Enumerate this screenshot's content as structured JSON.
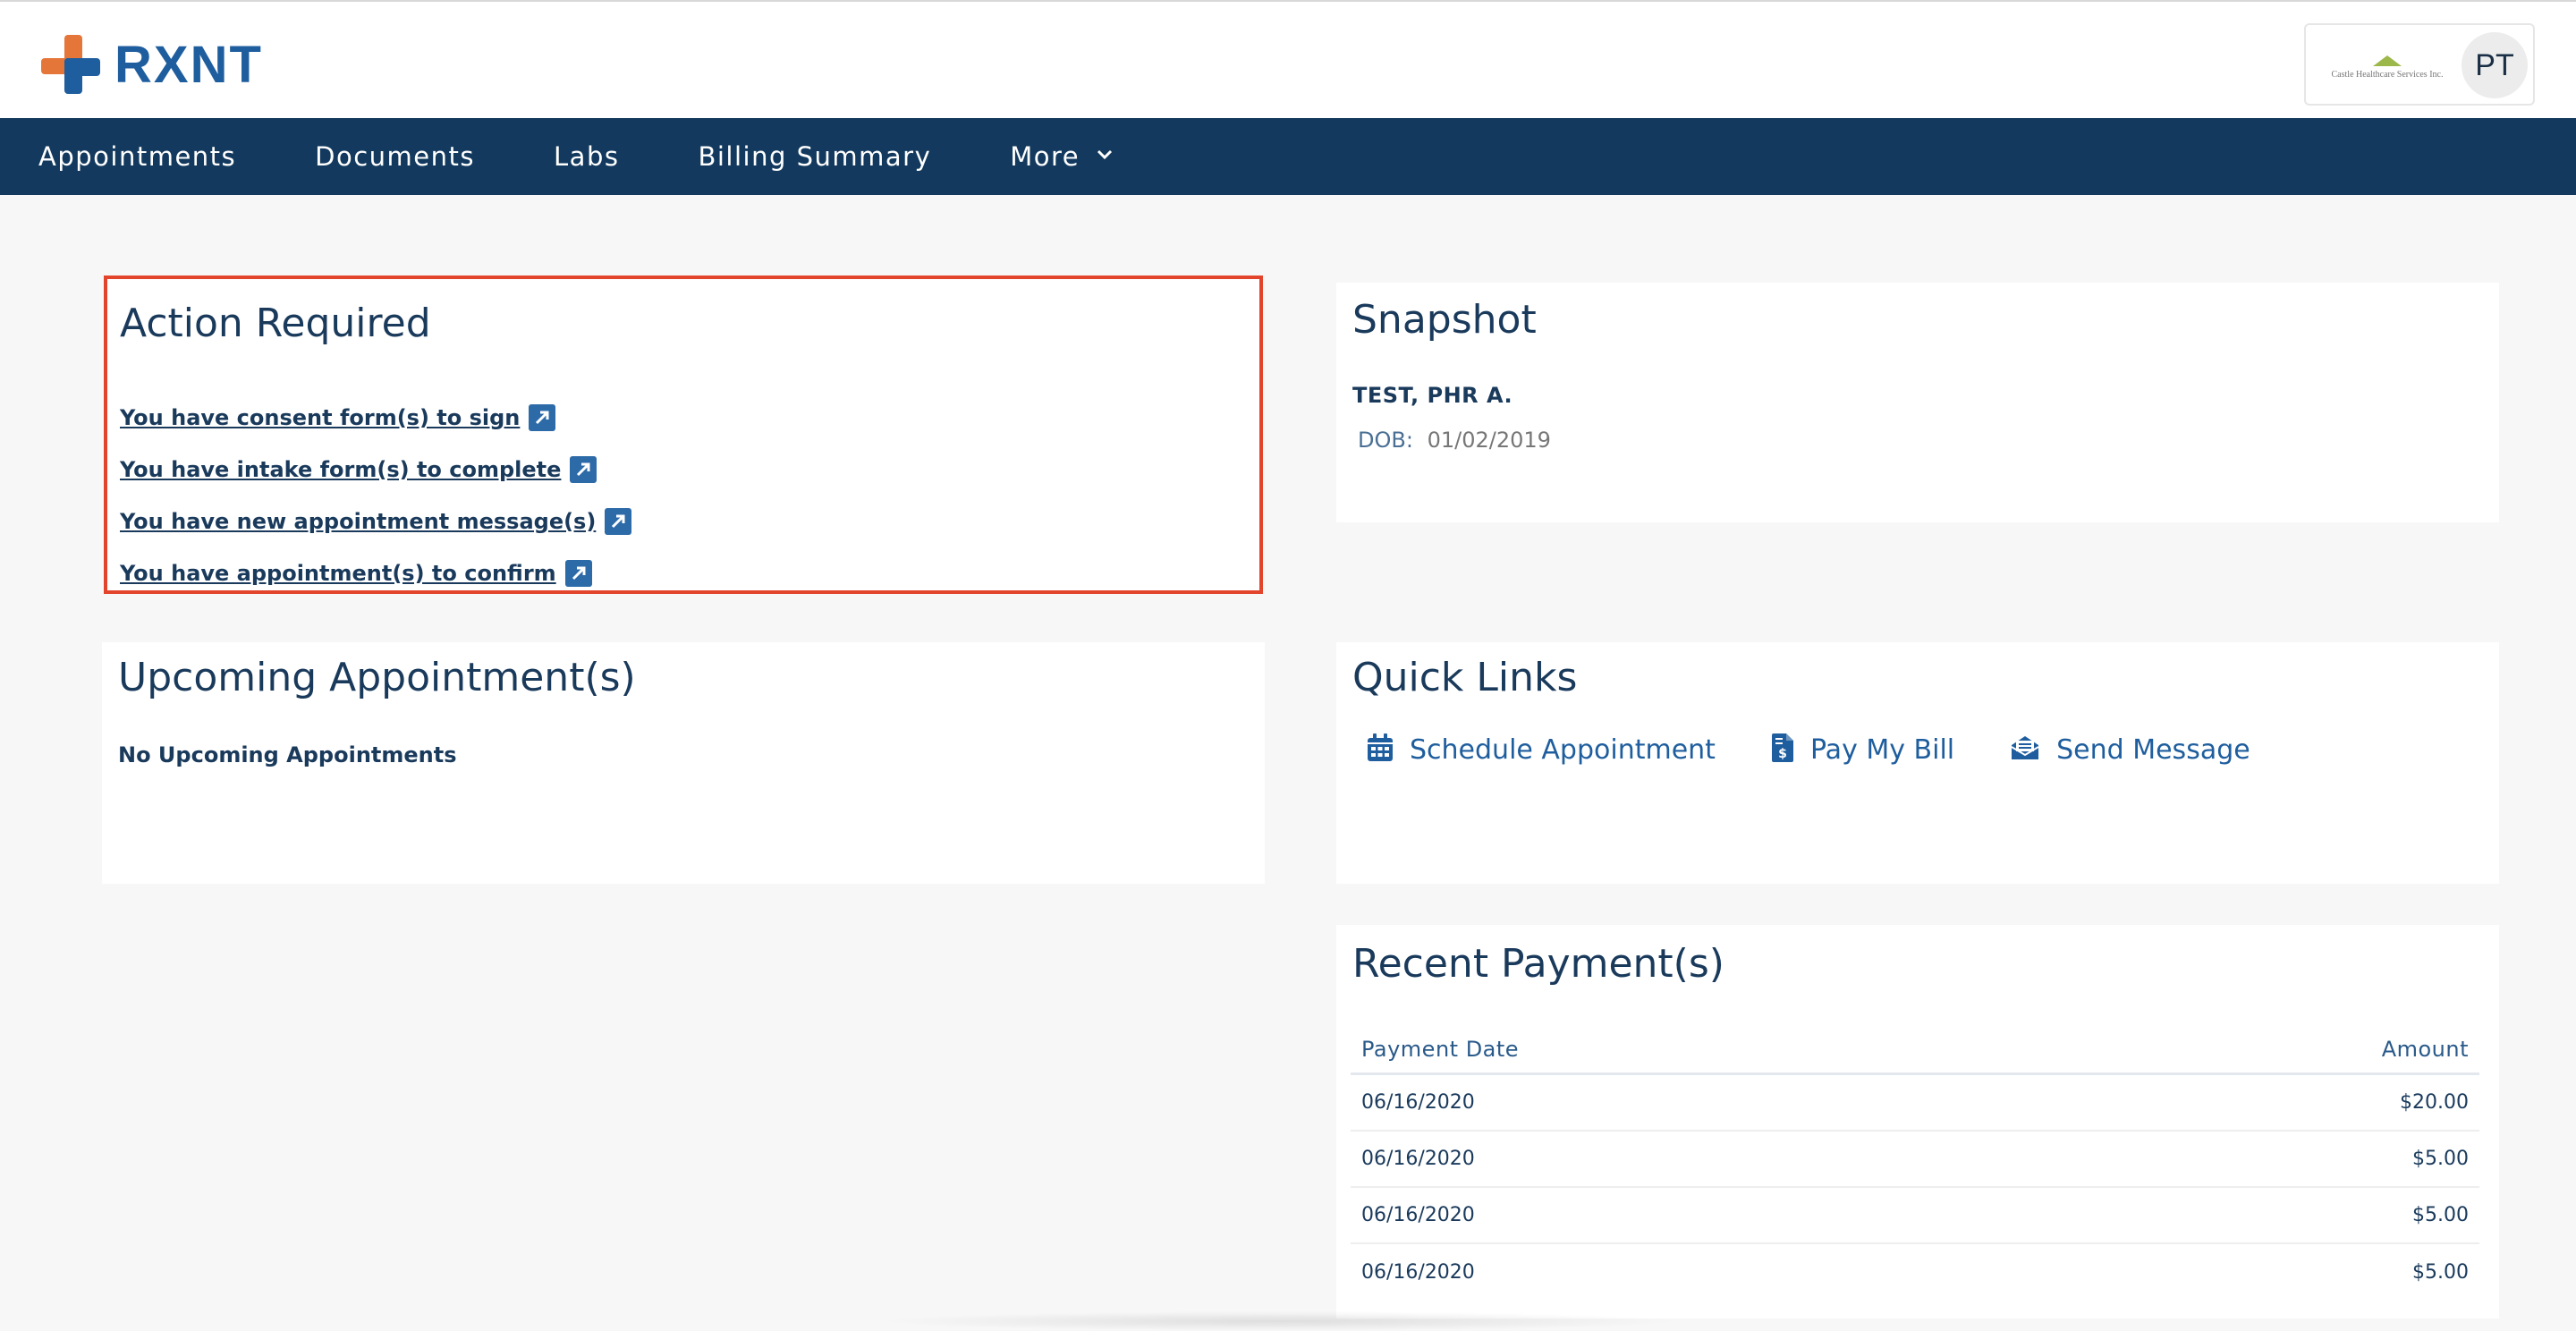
{
  "brand": {
    "name": "RXNT"
  },
  "account": {
    "practice_name": "Castle Healthcare Services Inc.",
    "practice_tagline": "",
    "avatar_initials": "PT"
  },
  "nav": {
    "items": [
      {
        "label": "Appointments"
      },
      {
        "label": "Documents"
      },
      {
        "label": "Labs"
      },
      {
        "label": "Billing Summary"
      },
      {
        "label": "More"
      }
    ]
  },
  "action_required": {
    "title": "Action Required",
    "items": [
      {
        "label": "You have consent form(s) to sign"
      },
      {
        "label": "You have intake form(s) to complete"
      },
      {
        "label": "You have new appointment message(s)"
      },
      {
        "label": "You have appointment(s) to confirm"
      }
    ]
  },
  "snapshot": {
    "title": "Snapshot",
    "patient_name": "TEST, PHR A.",
    "dob_label": "DOB:",
    "dob_value": "01/02/2019"
  },
  "upcoming": {
    "title": "Upcoming Appointment(s)",
    "empty_text": "No Upcoming Appointments"
  },
  "quick_links": {
    "title": "Quick Links",
    "items": [
      {
        "label": "Schedule Appointment",
        "icon": "calendar-icon"
      },
      {
        "label": "Pay My Bill",
        "icon": "bill-icon"
      },
      {
        "label": "Send Message",
        "icon": "envelope-icon"
      }
    ]
  },
  "payments": {
    "title": "Recent Payment(s)",
    "columns": [
      "Payment Date",
      "Amount"
    ],
    "rows": [
      {
        "date": "06/16/2020",
        "amount": "$20.00"
      },
      {
        "date": "06/16/2020",
        "amount": "$5.00"
      },
      {
        "date": "06/16/2020",
        "amount": "$5.00"
      },
      {
        "date": "06/16/2020",
        "amount": "$5.00"
      }
    ]
  },
  "colors": {
    "nav_bg": "#133a5e",
    "brand_blue": "#1f5e9e",
    "brand_orange": "#e5763a",
    "highlight_border": "#e2452b"
  }
}
